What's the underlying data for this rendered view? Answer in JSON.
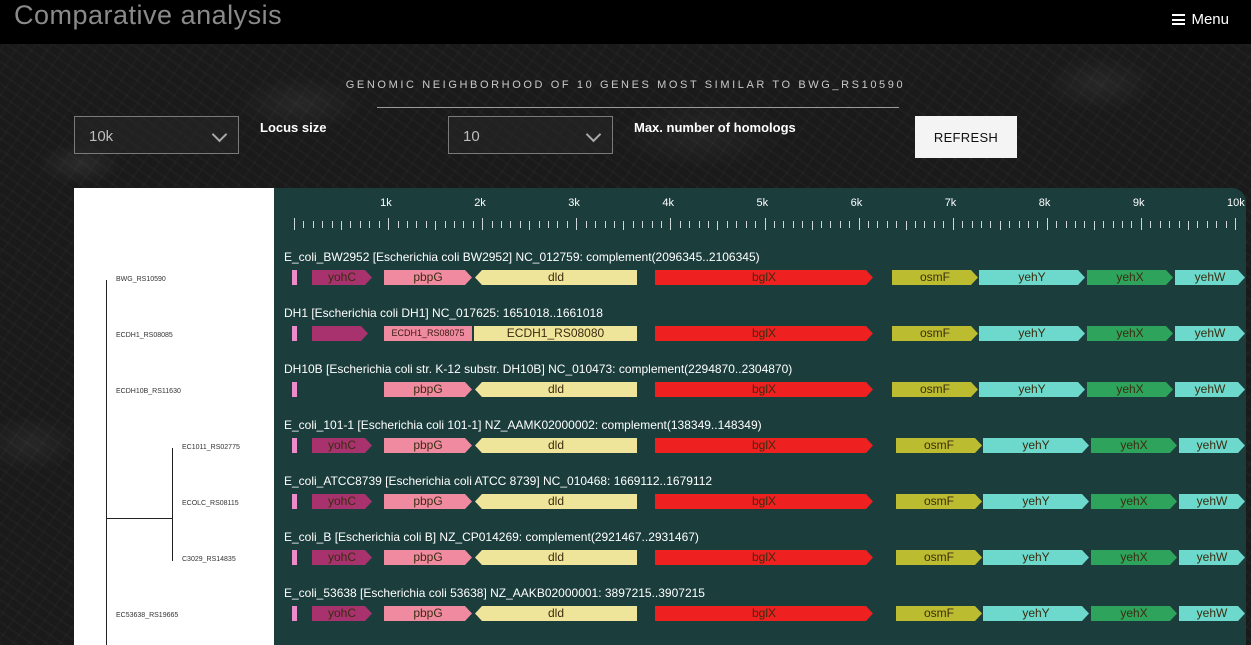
{
  "header": {
    "title": "Comparative analysis",
    "menu_label": "Menu"
  },
  "subtitle": "GENOMIC NEIGHBORHOOD OF 10 GENES MOST SIMILAR TO BWG_RS10590",
  "controls": {
    "locus_size_value": "10k",
    "locus_size_label": "Locus size",
    "homologs_value": "10",
    "homologs_label": "Max. number of homologs",
    "refresh_label": "REFRESH"
  },
  "ruler": {
    "labels": [
      "1k",
      "2k",
      "3k",
      "4k",
      "5k",
      "6k",
      "7k",
      "8k",
      "9k",
      "10k"
    ]
  },
  "colors": {
    "yohC": "#a8326e",
    "pbpG": "#ef8aa0",
    "dld": "#efe59a",
    "bglX": "#ee2020",
    "osmF": "#bcbc30",
    "yehY": "#6cd9cc",
    "yehX": "#2ea35b",
    "yehW": "#6cd9cc",
    "small": "#ef8acb",
    "ecdh_small": "#ef8aa0",
    "ecdh_big": "#efe59a"
  },
  "tree": {
    "labels": [
      "BWG_RS10590",
      "ECDH1_RS08085",
      "ECDH10B_RS11630",
      "EC1011_RS02775",
      "ECOLC_RS08115",
      "C3029_RS14835",
      "EC53638_RS19665"
    ]
  },
  "tracks": [
    {
      "title": "E_coli_BW2952 [Escherichia coli BW2952] NC_012759: complement(2096345..2106345)",
      "genes": [
        "",
        "yohC",
        "pbpG",
        "dld",
        "bglX",
        "osmF",
        "yehY",
        "yehX",
        "yehW"
      ]
    },
    {
      "title": "DH1 [Escherichia coli DH1] NC_017625: 1651018..1661018",
      "genes": [
        "",
        "",
        "ECDH1_RS08075",
        "ECDH1_RS08080",
        "bglX",
        "osmF",
        "yehY",
        "yehX",
        "yehW"
      ]
    },
    {
      "title": "DH10B [Escherichia coli str. K-12 substr. DH10B] NC_010473: complement(2294870..2304870)",
      "genes": [
        "",
        "",
        "pbpG",
        "dld",
        "bglX",
        "osmF",
        "yehY",
        "yehX",
        "yehW"
      ]
    },
    {
      "title": "E_coli_101-1 [Escherichia coli 101-1] NZ_AAMK02000002: complement(138349..148349)",
      "genes": [
        "",
        "yohC",
        "pbpG",
        "dld",
        "bglX",
        "osmF",
        "yehY",
        "yehX",
        "yehW"
      ]
    },
    {
      "title": "E_coli_ATCC8739 [Escherichia coli ATCC 8739] NC_010468: 1669112..1679112",
      "genes": [
        "",
        "yohC",
        "pbpG",
        "dld",
        "bglX",
        "osmF",
        "yehY",
        "yehX",
        "yehW"
      ]
    },
    {
      "title": "E_coli_B [Escherichia coli B] NZ_CP014269: complement(2921467..2931467)",
      "genes": [
        "",
        "yohC",
        "pbpG",
        "dld",
        "bglX",
        "osmF",
        "yehY",
        "yehX",
        "yehW"
      ]
    },
    {
      "title": "E_coli_53638 [Escherichia coli 53638] NZ_AAKB02000001: 3897215..3907215",
      "genes": [
        "",
        "yohC",
        "pbpG",
        "dld",
        "bglX",
        "osmF",
        "yehY",
        "yehX",
        "yehW"
      ]
    }
  ]
}
